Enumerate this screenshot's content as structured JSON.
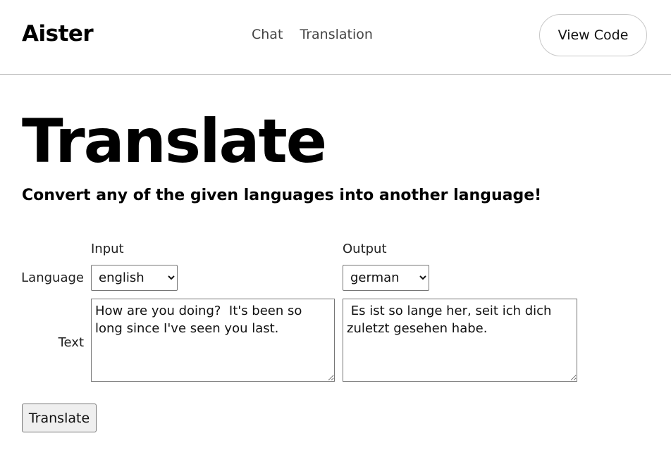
{
  "header": {
    "brand": "Aister",
    "nav": [
      {
        "label": "Chat"
      },
      {
        "label": "Translation"
      }
    ],
    "view_code_label": "View Code"
  },
  "main": {
    "title": "Translate",
    "subtitle": "Convert any of the given languages into another language!",
    "form": {
      "input_heading": "Input",
      "output_heading": "Output",
      "language_label": "Language",
      "text_label": "Text",
      "input_language": "english",
      "output_language": "german",
      "input_text": "How are you doing?  It's been so long since I've seen you last.",
      "output_text": " Es ist so lange her, seit ich dich zuletzt gesehen habe.",
      "submit_label": "Translate"
    }
  }
}
